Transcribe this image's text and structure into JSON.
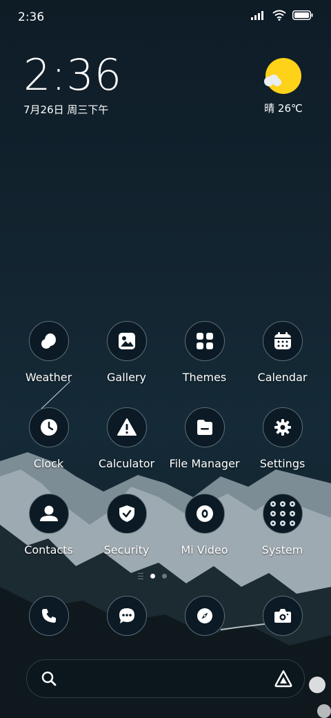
{
  "status_bar": {
    "time": "2:36"
  },
  "clock_widget": {
    "time": "2:36",
    "date": "7月26日 周三下午"
  },
  "weather_widget": {
    "condition_temp": "晴 26℃",
    "icon": "sunny-cloud-icon",
    "sun_color": "#ffd21a"
  },
  "apps": [
    {
      "label": "Weather",
      "icon": "weather-icon"
    },
    {
      "label": "Gallery",
      "icon": "gallery-icon"
    },
    {
      "label": "Themes",
      "icon": "themes-icon"
    },
    {
      "label": "Calendar",
      "icon": "calendar-icon"
    },
    {
      "label": "Clock",
      "icon": "clock-icon"
    },
    {
      "label": "Calculator",
      "icon": "warning-icon"
    },
    {
      "label": "File Manager",
      "icon": "folder-icon"
    },
    {
      "label": "Settings",
      "icon": "gear-icon"
    },
    {
      "label": "Contacts",
      "icon": "person-icon"
    },
    {
      "label": "Security",
      "icon": "shield-icon"
    },
    {
      "label": "Mi Video",
      "icon": "video-icon"
    },
    {
      "label": "System",
      "icon": "folder-grid-icon"
    }
  ],
  "dock": [
    {
      "icon": "phone-icon"
    },
    {
      "icon": "messages-icon"
    },
    {
      "icon": "compass-icon"
    },
    {
      "icon": "camera-icon"
    }
  ],
  "page_indicator": {
    "pages": 2,
    "current": 1
  },
  "search_bar": {
    "left_icon": "search-icon",
    "right_icon": "assistant-icon"
  }
}
